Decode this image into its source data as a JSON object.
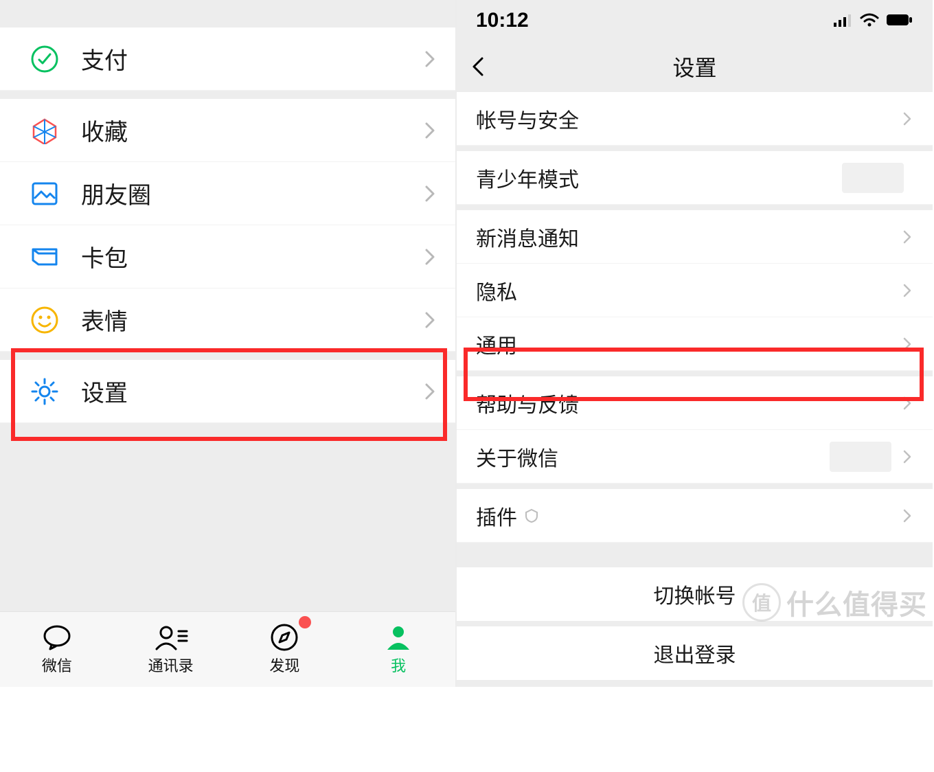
{
  "left": {
    "menu": {
      "pay": "支付",
      "favorites": "收藏",
      "moments": "朋友圈",
      "cards": "卡包",
      "stickers": "表情",
      "settings": "设置"
    },
    "tabs": {
      "chat": "微信",
      "contacts": "通讯录",
      "discover": "发现",
      "me": "我"
    }
  },
  "right": {
    "status_time": "10:12",
    "nav_title": "设置",
    "items": {
      "account_security": "帐号与安全",
      "youth_mode": "青少年模式",
      "new_msg_notify": "新消息通知",
      "privacy": "隐私",
      "general": "通用",
      "help_feedback": "帮助与反馈",
      "about": "关于微信",
      "plugins": "插件",
      "switch_account": "切换帐号",
      "logout": "退出登录"
    }
  },
  "watermark": {
    "badge": "值",
    "text": "什么值得买"
  }
}
